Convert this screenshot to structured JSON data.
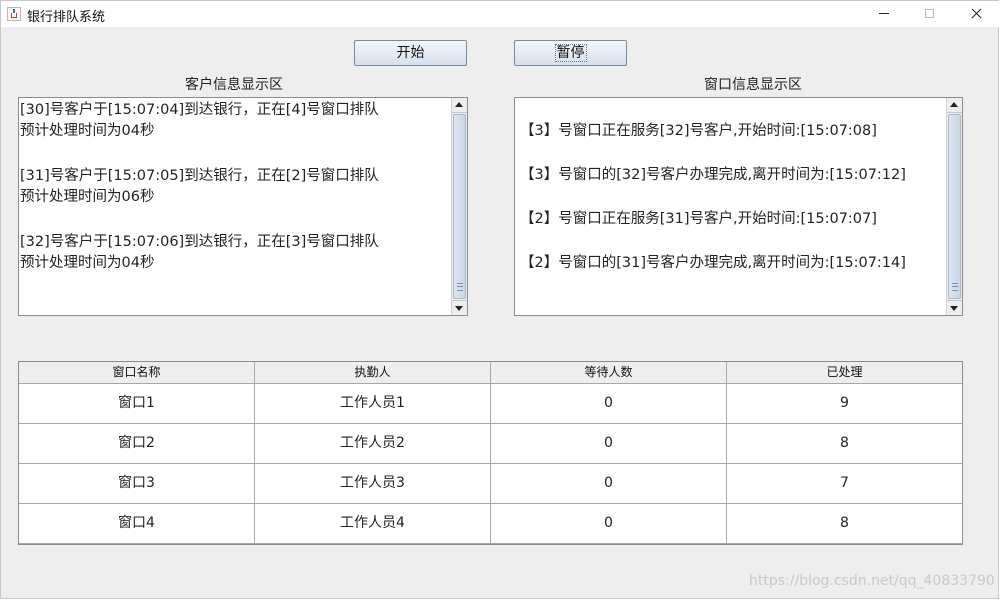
{
  "window": {
    "title": "银行排队系统"
  },
  "toolbar": {
    "start_label": "开始",
    "pause_label": "暂停"
  },
  "customer_panel": {
    "title": "客户信息显示区",
    "lines": [
      "[30]号客户于[15:07:04]到达银行，正在[4]号窗口排队",
      "预计处理时间为04秒",
      "[31]号客户于[15:07:05]到达银行，正在[2]号窗口排队",
      "预计处理时间为06秒",
      "[32]号客户于[15:07:06]到达银行，正在[3]号窗口排队",
      "预计处理时间为04秒"
    ]
  },
  "window_panel": {
    "title": "窗口信息显示区",
    "lines": [
      "【3】号窗口正在服务[32]号客户,开始时间:[15:07:08]",
      "【3】号窗口的[32]号客户办理完成,离开时间为:[15:07:12]",
      "【2】号窗口正在服务[31]号客户,开始时间:[15:07:07]",
      "【2】号窗口的[31]号客户办理完成,离开时间为:[15:07:14]"
    ]
  },
  "table": {
    "columns": [
      "窗口名称",
      "执勤人",
      "等待人数",
      "已处理"
    ],
    "rows": [
      [
        "窗口1",
        "工作人员1",
        "0",
        "9"
      ],
      [
        "窗口2",
        "工作人员2",
        "0",
        "8"
      ],
      [
        "窗口3",
        "工作人员3",
        "0",
        "7"
      ],
      [
        "窗口4",
        "工作人员4",
        "0",
        "8"
      ]
    ]
  },
  "watermark": "https://blog.csdn.net/qq_40833790",
  "colors": {
    "background": "#eeeeee",
    "button_border": "#7a8aa3",
    "grid_line": "#a7a7a7"
  }
}
